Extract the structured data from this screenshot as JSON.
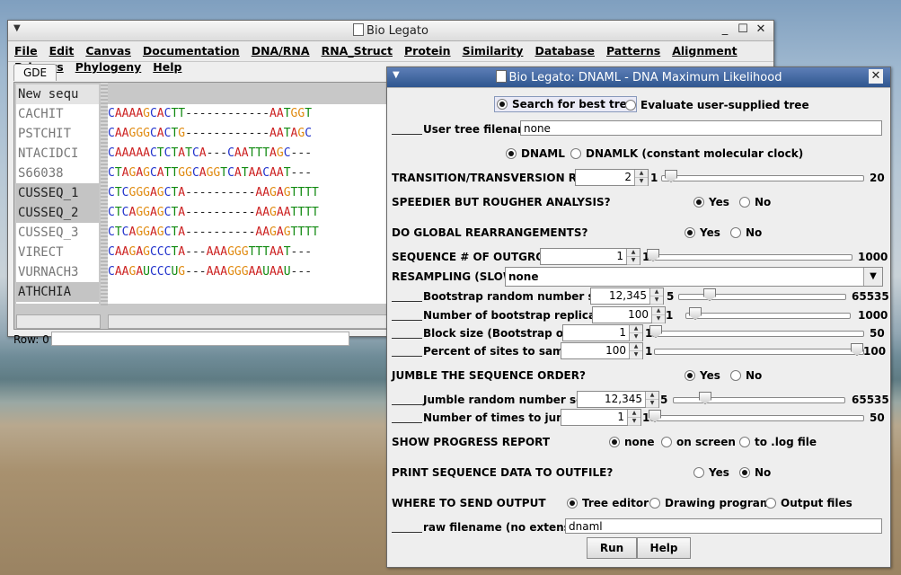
{
  "main": {
    "title": "Bio Legato",
    "menu": [
      "File",
      "Edit",
      "Canvas",
      "Documentation",
      "DNA/RNA",
      "RNA_Struct",
      "Protein",
      "Similarity",
      "Database",
      "Patterns",
      "Alignment",
      "Primers",
      "Phylogeny",
      "Help"
    ],
    "tab": "GDE",
    "names_header": "New sequ",
    "names": [
      "CACHIT",
      "PSTCHIT",
      "NTACIDCI",
      "S66038",
      "CUSSEQ_1",
      "CUSSEQ_2",
      "CUSSEQ_3",
      "VIRECT",
      "VURNACH3",
      "ATHCHIA"
    ],
    "sequences": [
      "CAAAAGCACTT------------AATGGT",
      "CAAGGGCACTG------------AATAGC",
      "CAAAAACTCTATCA---CAATTTAGC---",
      "CTAGAGCATTGGCAGGTCATAACAAT---",
      "CTCGGGAGCTA----------AAGAGTTTT",
      "CTCAGGAGCTA----------AAGAATTTT",
      "CTCAGGAGCTA----------AAGAGTTTT",
      "CAAGAGCCCTA---AAAGGGTTTAAT---",
      "CAAGAUCCCUG---AAAGGGAAUAAU---"
    ],
    "status": "Row: 0"
  },
  "colors": {
    "A": "#cc2222",
    "C": "#2233cc",
    "G": "#e08a10",
    "T": "#118a11",
    "U": "#118a11",
    "-": "#222222"
  },
  "dialog": {
    "title": "Bio Legato: DNAML - DNA Maximum Likelihood",
    "tree_mode": {
      "opt1": "Search for best tree",
      "opt2": "Evaluate user-supplied tree"
    },
    "user_tree": {
      "label": "User tree filename:",
      "value": "none"
    },
    "model": {
      "opt1": "DNAML",
      "opt2": "DNAMLK (constant molecular clock)"
    },
    "ttratio": {
      "label": "TRANSITION/TRANSVERSION RATIO:",
      "value": "2",
      "min": "1",
      "max": "20"
    },
    "speedier": {
      "label": "SPEEDIER BUT ROUGHER ANALYSIS?",
      "yes": "Yes",
      "no": "No"
    },
    "global": {
      "label": "DO GLOBAL REARRANGEMENTS?",
      "yes": "Yes",
      "no": "No"
    },
    "outgroup": {
      "label": "SEQUENCE # OF OUTGROUP::",
      "value": "1",
      "min": "1",
      "max": "1000"
    },
    "resampling": {
      "label": "RESAMPLING (SLOW!)",
      "value": "none"
    },
    "bseed": {
      "label": "Bootstrap random number seed:",
      "value": "12,345",
      "min": "5",
      "max": "65535"
    },
    "breps": {
      "label": "Number of bootstrap replicates?:",
      "value": "100",
      "min": "1",
      "max": "1000"
    },
    "block": {
      "label": "Block size (Bootstrap only):",
      "value": "1",
      "min": "1",
      "max": "50"
    },
    "percent": {
      "label": "Percent of sites to sample:",
      "value": "100",
      "min": "1",
      "max": "100"
    },
    "jumble": {
      "label": "JUMBLE THE SEQUENCE ORDER?",
      "yes": "Yes",
      "no": "No"
    },
    "jseed": {
      "label": "Jumble random number seed:",
      "value": "12,345",
      "min": "5",
      "max": "65535"
    },
    "jtimes": {
      "label": "Number of times to jumble:",
      "value": "1",
      "min": "1",
      "max": "50"
    },
    "progress": {
      "label": "SHOW PROGRESS REPORT",
      "o1": "none",
      "o2": "on screen",
      "o3": "to .log file"
    },
    "printseq": {
      "label": "PRINT SEQUENCE DATA TO OUTFILE?",
      "yes": "Yes",
      "no": "No"
    },
    "output": {
      "label": "WHERE TO SEND OUTPUT",
      "o1": "Tree editor",
      "o2": "Drawing program",
      "o3": "Output files"
    },
    "rawfile": {
      "label": "raw filename (no extension)",
      "value": "dnaml"
    },
    "run": "Run",
    "help": "Help"
  }
}
